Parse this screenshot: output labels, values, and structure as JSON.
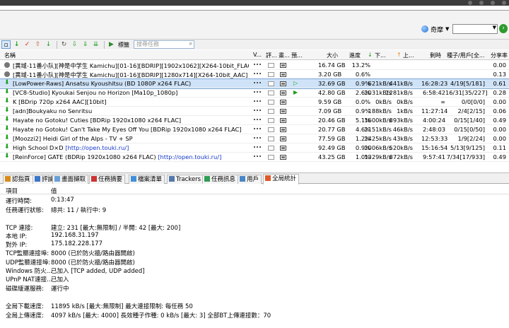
{
  "toolbar": {
    "add_label": "",
    "labels_label": "標籤",
    "filter_placeholder": "搜尋任務"
  },
  "search": {
    "engine_label": "奇摩",
    "query": ""
  },
  "columns": {
    "name": "名稱",
    "v": "V...",
    "rating": "評...",
    "media": "畫...",
    "preview": "預...",
    "size": "大小",
    "progress": "進度",
    "down": "下...",
    "up": "上...",
    "eta": "剩時",
    "seeds": "種子/用戶[全...",
    "ratio": "分享率"
  },
  "torrents": [
    {
      "name": "[異域-11番小队][神是中学生 Kamichu][01-16][BDRIP][1902x1062][X264-10bit_FLAC_AACx2]",
      "link": "",
      "status": "paused",
      "media": true,
      "play": "",
      "size": "16.74 GB",
      "progress": "13.2%",
      "down": "",
      "up": "",
      "eta": "",
      "seeds": "",
      "ratio": "0.00"
    },
    {
      "name": "[異域-11番小队][神是中学生 Kamichu][01-16][BDRIP][1280x714][X264-10bit_AAC]",
      "link": "",
      "status": "paused",
      "media": true,
      "play": "",
      "size": "3.20 GB",
      "progress": "0.6%",
      "down": "",
      "up": "",
      "eta": "",
      "seeds": "",
      "ratio": "0.13"
    },
    {
      "name": "[LowPower-Raws] Ansatsu Kyoushitsu (BD 1080P x264 FLAC)",
      "link": "",
      "status": "down",
      "media": true,
      "play": "hollow",
      "size": "32.69 GB",
      "progress": "0.9%",
      "down": "621kB/s",
      "up": "441kB/s",
      "eta": "16:28:23",
      "seeds": "4/19[5/181]",
      "ratio": "0.61"
    },
    {
      "name": "[VC8-Studio] Kyoukai Senjou no Horizon [Ma10p_1080p]",
      "link": "",
      "status": "down",
      "media": true,
      "play": "solid",
      "size": "42.80 GB",
      "progress": "2.6%",
      "down": "2031kB/s",
      "up": "1281kB/s",
      "eta": "6:58:42",
      "seeds": "16/31[35/227]",
      "ratio": "0.28"
    },
    {
      "name": "K [BDrip 720p x264 AAC][10bit]",
      "link": "",
      "status": "down",
      "media": true,
      "play": "",
      "size": "9.59 GB",
      "progress": "0.0%",
      "down": "0kB/s",
      "up": "0kB/s",
      "eta": "∞",
      "seeds": "0/0[0/0]",
      "ratio": "0.00"
    },
    {
      "name": "[adn]Boukyaku no Senritsu",
      "link": "",
      "status": "down",
      "media": true,
      "play": "",
      "size": "7.09 GB",
      "progress": "0.9%",
      "down": "188kB/s",
      "up": "1kB/s",
      "eta": "11:27:14",
      "seeds": "2/4[2/15]",
      "ratio": "0.06"
    },
    {
      "name": "Hayate no Gotoku! Cuties [BDRip 1920x1080 x264 FLAC]",
      "link": "",
      "status": "down",
      "media": true,
      "play": "",
      "size": "20.46 GB",
      "progress": "5.1%",
      "down": "1600kB/s",
      "up": "893kB/s",
      "eta": "4:00:24",
      "seeds": "0/15[1/40]",
      "ratio": "0.49"
    },
    {
      "name": "Hayate no Gotoku! Can't Take My Eyes Off You [BDRip 1920x1080 x264 FLAC]",
      "link": "",
      "status": "down",
      "media": true,
      "play": "",
      "size": "20.77 GB",
      "progress": "4.6%",
      "down": "2151kB/s",
      "up": "46kB/s",
      "eta": "2:48:03",
      "seeds": "0/15[0/50]",
      "ratio": "0.00"
    },
    {
      "name": "[Moozzi2] Heidi Girl of the Alps - TV + SP",
      "link": "",
      "status": "down",
      "media": true,
      "play": "",
      "size": "77.59 GB",
      "progress": "1.2%",
      "down": "2425kB/s",
      "up": "43kB/s",
      "eta": "12:53:33",
      "seeds": "1/9[2/24]",
      "ratio": "0.00"
    },
    {
      "name": "High School D×D ",
      "link": "[http://open.touki.ru/]",
      "status": "down",
      "media": true,
      "play": "",
      "size": "92.49 GB",
      "progress": "0.9%",
      "down": "2006kB/s",
      "up": "520kB/s",
      "eta": "15:16:54",
      "seeds": "5/13[9/125]",
      "ratio": "0.11"
    },
    {
      "name": "[ReinForce] GATE (BDRip 1920x1080 x264 FLAC) ",
      "link": "[http://open.touki.ru/]",
      "status": "down",
      "media": true,
      "play": "",
      "size": "43.25 GB",
      "progress": "1.0%",
      "down": "1329kB/s",
      "up": "872kB/s",
      "eta": "9:57:41",
      "seeds": "7/34[17/933]",
      "ratio": "0.49"
    }
  ],
  "tabs": [
    {
      "label": "認指頁",
      "color": "#d98b1a"
    },
    {
      "label": "評論",
      "color": "#3a76c9"
    },
    {
      "label": "畫面擷取",
      "color": "#6aa0d8"
    },
    {
      "label": "任務摘要",
      "color": "#cc3333"
    },
    {
      "label": "檔案清單",
      "color": "#3f8fd8"
    },
    {
      "label": "Trackers",
      "color": "#5577aa"
    },
    {
      "label": "任務訊息",
      "color": "#2f9d56"
    },
    {
      "label": "用戶",
      "color": "#4a86c8"
    },
    {
      "label": "全局統計",
      "color": "#e05a2a"
    }
  ],
  "info": {
    "header_key": "項目",
    "header_val": "值",
    "lines": [
      {
        "k": "運行時間:",
        "v": "0:13:47"
      },
      {
        "k": "任務運行狀態:",
        "v": "總共: 11 / 執行中: 9"
      },
      {
        "k": "TCP 連接:",
        "v": "建立: 231 [最大:無限制] / 半開: 42 [最大: 200]"
      },
      {
        "k": "本地 IP:",
        "v": "192.168.31.197"
      },
      {
        "k": "對外 IP:",
        "v": "175.182.228.177"
      },
      {
        "k": "TCP監聽連接埠:",
        "v": "8000 (已於防火牆/路由器開啟)"
      },
      {
        "k": "UDP監聽連接埠:",
        "v": "8000 (已於防火牆/路由器開啟)"
      },
      {
        "k": "Windows 防火...",
        "v": "已加入 [TCP added, UDP added]"
      },
      {
        "k": "UPnP NAT連接...",
        "v": "已加入"
      },
      {
        "k": "磁碟緩運服務:",
        "v": "運行中"
      },
      {
        "k": "全局下載速度:",
        "v": "11895 kB/s [最大:無限制]      最大連接限制: 每任務 50"
      },
      {
        "k": "全局上傳速度:",
        "v": "4097 kB/s [最大: 4000]     長效種子作種: 0 kB/s [最大: 3]     全部BT上傳連接數：70"
      }
    ]
  }
}
